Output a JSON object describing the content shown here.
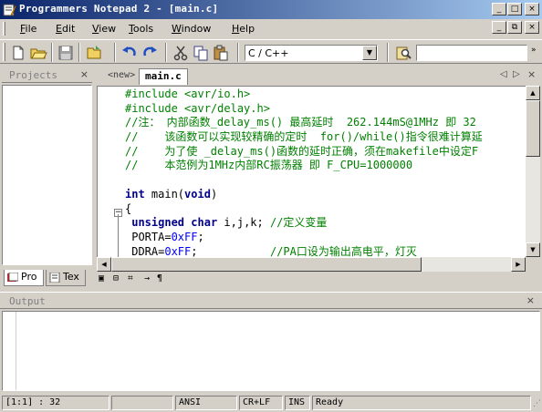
{
  "window": {
    "title": "Programmers Notepad 2 - [main.c]",
    "controls": {
      "minimize": "_",
      "maximize": "□",
      "close": "×"
    },
    "mdi_controls": {
      "minimize": "_",
      "restore": "⧉",
      "close": "×"
    }
  },
  "menu": {
    "items": [
      {
        "accel": "F",
        "rest": "ile"
      },
      {
        "accel": "E",
        "rest": "dit"
      },
      {
        "accel": "V",
        "rest": "iew"
      },
      {
        "accel": "T",
        "rest": "ools"
      },
      {
        "accel": "W",
        "rest": "indow"
      },
      {
        "accel": "H",
        "rest": "elp"
      }
    ]
  },
  "toolbar": {
    "scheme": "C / C++",
    "scheme_arrow": "▼",
    "search_value": "",
    "more": "»"
  },
  "projects_panel": {
    "title": "Projects",
    "close": "×",
    "tabs": [
      "Pro",
      "Tex"
    ]
  },
  "editor_tabs": {
    "tabs": [
      {
        "label": "<new>",
        "active": false
      },
      {
        "label": "main.c",
        "active": true
      }
    ],
    "nav_prev": "◁",
    "nav_next": "▷",
    "close": "×"
  },
  "code_lines": [
    [
      {
        "t": "pp",
        "s": "#include <avr/io.h>"
      }
    ],
    [
      {
        "t": "pp",
        "s": "#include <avr/delay.h>"
      }
    ],
    [
      {
        "t": "com",
        "s": "//注： 内部函数_delay_ms() 最高延时  262.144mS@1MHz 即 32"
      }
    ],
    [
      {
        "t": "com",
        "s": "//    该函数可以实现较精确的定时  for()/while()指令很难计算延"
      }
    ],
    [
      {
        "t": "com",
        "s": "//    为了使 _delay_ms()函数的延时正确，须在makefile中设定F"
      }
    ],
    [
      {
        "t": "com",
        "s": "//    本范例为1MHz内部RC振荡器 即 F_CPU=1000000"
      }
    ],
    [
      {
        "t": "nrm",
        "s": ""
      }
    ],
    [
      {
        "t": "kw",
        "s": "int"
      },
      {
        "t": "nrm",
        "s": " main("
      },
      {
        "t": "kw",
        "s": "void"
      },
      {
        "t": "nrm",
        "s": ")"
      }
    ],
    [
      {
        "t": "nrm",
        "s": "{"
      }
    ],
    [
      {
        "t": "nrm",
        "s": " "
      },
      {
        "t": "kw",
        "s": "unsigned"
      },
      {
        "t": "nrm",
        "s": " "
      },
      {
        "t": "kw",
        "s": "char"
      },
      {
        "t": "nrm",
        "s": " i,j,k; "
      },
      {
        "t": "com",
        "s": "//定义变量"
      }
    ],
    [
      {
        "t": "nrm",
        "s": " PORTA="
      },
      {
        "t": "num",
        "s": "0xFF"
      },
      {
        "t": "nrm",
        "s": ";"
      }
    ],
    [
      {
        "t": "nrm",
        "s": " DDRA="
      },
      {
        "t": "num",
        "s": "0xFF"
      },
      {
        "t": "nrm",
        "s": ";           "
      },
      {
        "t": "com",
        "s": "//PA口设为输出高电平，灯灭"
      }
    ]
  ],
  "edit_icons": [
    "▣",
    "⊟",
    "⌗",
    "→",
    "¶"
  ],
  "output_panel": {
    "title": "Output",
    "close": "×"
  },
  "statusbar": {
    "position": "[1:1] : 32",
    "empty": "",
    "encoding": "ANSI",
    "line_endings": "CR+LF",
    "mode": "INS",
    "status": "Ready"
  },
  "colors": {
    "title_start": "#0a246a",
    "title_end": "#a6caf0",
    "comment": "#008000",
    "keyword": "#00008b",
    "number": "#0000ff"
  }
}
